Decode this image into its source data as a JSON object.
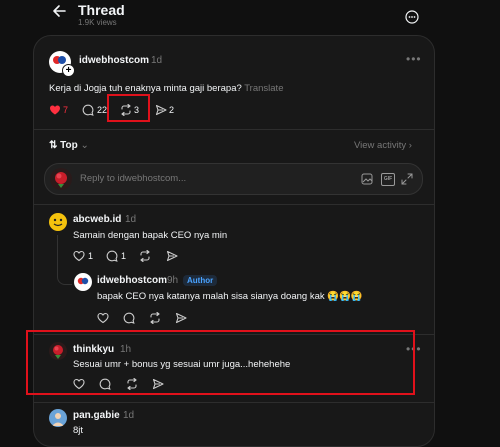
{
  "header": {
    "title": "Thread",
    "views": "1.9K views"
  },
  "post": {
    "username": "idwebhostcom",
    "time": "1d",
    "text": "Kerja di Jogja tuh enaknya minta gaji berapa?",
    "translate": "Translate",
    "likes": "7",
    "replies": "22",
    "reposts": "3",
    "shares": "2"
  },
  "sort": {
    "label": "Top",
    "view_activity": "View activity"
  },
  "reply_box": {
    "placeholder": "Reply to idwebhostcom..."
  },
  "comments": [
    {
      "username": "abcweb.id",
      "time": "1d",
      "text": "Samain dengan bapak CEO nya min",
      "likes": "1",
      "replies": "1"
    },
    {
      "username": "idwebhostcom",
      "time": "9h",
      "badge": "Author",
      "text": "bapak CEO nya katanya malah sisa sianya doang kak 😭😭😭"
    },
    {
      "username": "thinkkyu",
      "time": "1h",
      "text": "Sesuai umr + bonus yg sesuai umr juga...hehehehe"
    },
    {
      "username": "pan.gabie",
      "time": "1d",
      "text": "8jt"
    }
  ],
  "highlight_color": "#e0111b",
  "like_color": "#ff3040"
}
